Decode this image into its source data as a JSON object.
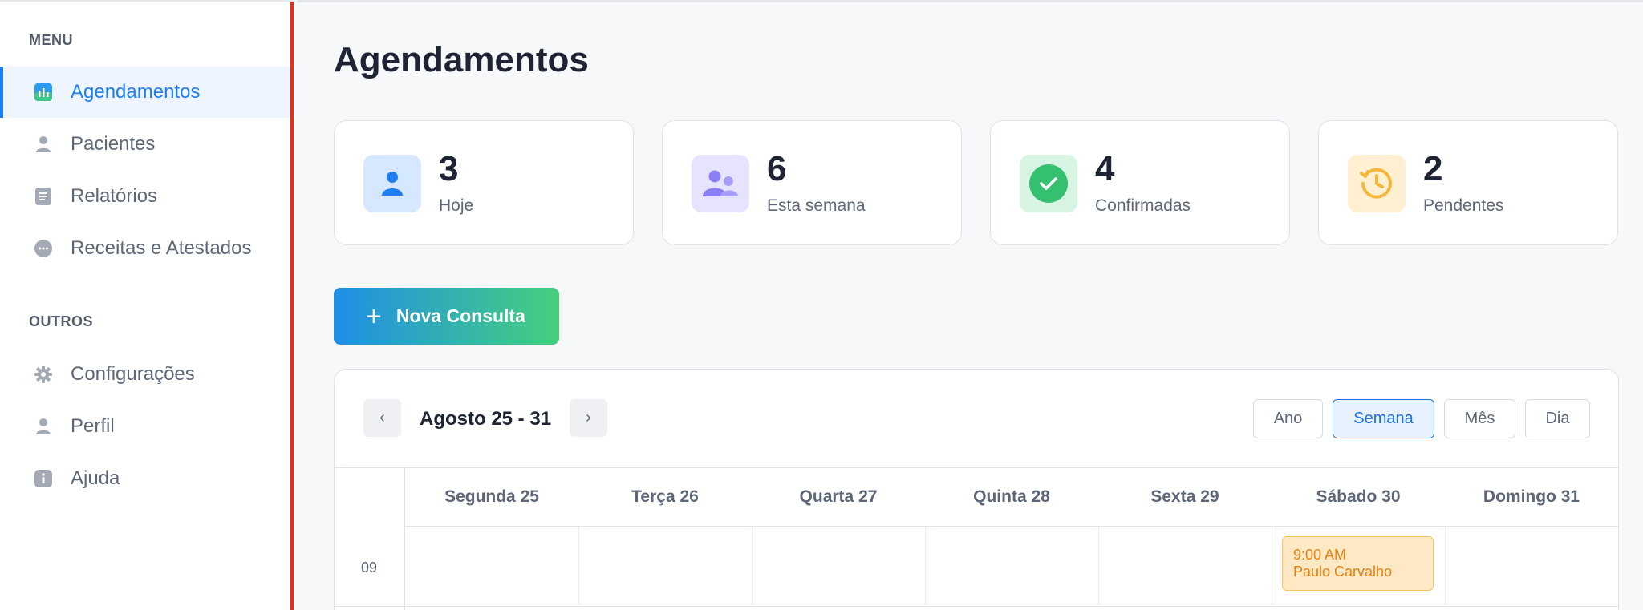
{
  "sidebar": {
    "menu_title": "MENU",
    "menu_items": [
      {
        "label": "Agendamentos",
        "icon": "chart-icon",
        "active": true
      },
      {
        "label": "Pacientes",
        "icon": "user-icon"
      },
      {
        "label": "Relatórios",
        "icon": "document-icon"
      },
      {
        "label": "Receitas e Atestados",
        "icon": "chat-icon"
      }
    ],
    "others_title": "OUTROS",
    "other_items": [
      {
        "label": "Configurações",
        "icon": "gear-icon"
      },
      {
        "label": "Perfil",
        "icon": "user-icon"
      },
      {
        "label": "Ajuda",
        "icon": "info-icon"
      }
    ]
  },
  "page": {
    "title": "Agendamentos"
  },
  "stats": [
    {
      "value": "3",
      "label": "Hoje",
      "icon": "person-icon",
      "color": "#1f7ff0"
    },
    {
      "value": "6",
      "label": "Esta semana",
      "icon": "people-icon",
      "color": "#7b6ef6"
    },
    {
      "value": "4",
      "label": "Confirmadas",
      "icon": "check-circle-icon",
      "color": "#34c06e"
    },
    {
      "value": "2",
      "label": "Pendentes",
      "icon": "history-clock-icon",
      "color": "#f5b73b"
    }
  ],
  "new_consult_button": {
    "label": "Nova Consulta",
    "icon": "plus-icon"
  },
  "calendar": {
    "prev": "‹",
    "next": "›",
    "range": "Agosto 25 - 31",
    "views": [
      "Ano",
      "Semana",
      "Mês",
      "Dia"
    ],
    "active_view": "Semana",
    "days": [
      "Segunda 25",
      "Terça 26",
      "Quarta 27",
      "Quinta 28",
      "Sexta 29",
      "Sábado 30",
      "Domingo 31"
    ],
    "hours": [
      "09"
    ],
    "events": [
      {
        "time": "9:00 AM",
        "patient": "Paulo Carvalho",
        "day": "Sábado 30",
        "hour": "09"
      }
    ]
  },
  "colors": {
    "accent": "#1f7ff0",
    "sidebar_border": "#e2301e",
    "event_bg": "#ffe9c4",
    "event_text": "#e7800f"
  }
}
